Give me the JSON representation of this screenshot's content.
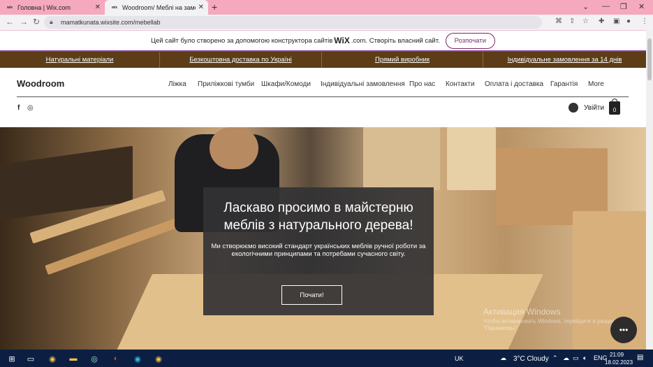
{
  "browser": {
    "tabs": [
      {
        "favicon": "wix",
        "title": "Головна | Wix.com"
      },
      {
        "favicon": "wix",
        "title": "Woodroom/ Меблі на замовлен"
      }
    ],
    "url": "mamatkunata.wixsite.com/mebellab"
  },
  "wix_banner": {
    "text_before": "Цей сайт було створено за допомогою конструктора сайтів",
    "brand": "WiX",
    "text_after": ".com. Створіть власний сайт.",
    "button": "Розпочати"
  },
  "promo": [
    "Натуральні матеріали",
    "Безкоштовна доставка по Україні",
    "Прямий виробник",
    "Індивідуальне замовлення за 14 днів"
  ],
  "header": {
    "logo": "Woodroom",
    "nav": [
      "Ліжка",
      "Приліжкові тумби",
      "Шкафи/Комоди",
      "Індивідуальні замовлення",
      "Про нас",
      "Контакти",
      "Оплата і доставка",
      "Гарантія",
      "More"
    ],
    "login": "Увійти",
    "cart_count": "0"
  },
  "hero": {
    "title": "Ласкаво просимо в майстерню меблів з натурального дерева!",
    "text": "Ми створюємо високий стандарт українських меблів ручної роботи за екологічними принципами та потребами сучасного світу.",
    "button": "Почати!"
  },
  "watermark": {
    "line1": "Активация Windows",
    "line2": "Чтобы активировать Windows, перейдите в раздел \"Параметры\"."
  },
  "taskbar": {
    "lang": "UK",
    "weather": "3°C  Cloudy",
    "time": "21:09",
    "date": "18.02.2023"
  },
  "colors": {
    "tabbar": "#f5a9bf",
    "promobar": "#5c3d17",
    "accent": "#7b2a65",
    "taskbar": "#0c1f43"
  }
}
